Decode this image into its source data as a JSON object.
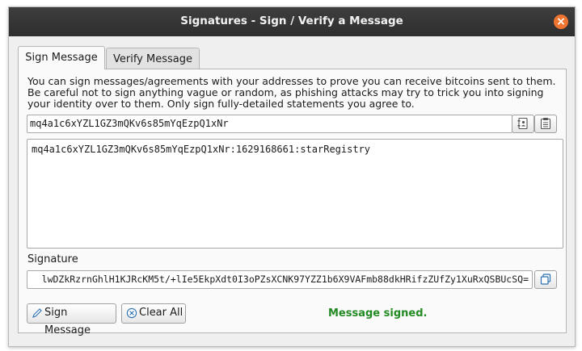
{
  "window": {
    "title": "Signatures - Sign / Verify a Message"
  },
  "tabs": [
    {
      "label": "Sign Message",
      "active": true
    },
    {
      "label": "Verify Message",
      "active": false
    }
  ],
  "sign": {
    "info": "You can sign messages/agreements with your addresses to prove you can receive bitcoins sent to them. Be careful not to sign anything vague or random, as phishing attacks may try to trick you into signing your identity over to them. Only sign fully-detailed statements you agree to.",
    "address": "mq4a1c6xYZL1GZ3mQKv6s85mYqEzpQ1xNr",
    "message": "mq4a1c6xYZL1GZ3mQKv6s85mYqEzpQ1xNr:1629168661:starRegistry",
    "signature_label": "Signature",
    "signature": "lwDZkRzrnGhlH1KJRcKM5t/+lIe5EkpXdt0I3oPZsXCNK97YZZ1b6X9VAFmb88dkHRifzZUfZy1XuRxQSBUcSQ=",
    "sign_button": "Sign Message",
    "clear_button": "Clear All",
    "status": "Message signed."
  },
  "colors": {
    "titlebar": "#353535",
    "close": "#ef7430",
    "status": "#238a23"
  },
  "icons": {
    "close": "close-icon",
    "address_book": "address-book-icon",
    "paste": "paste-icon",
    "copy": "copy-icon",
    "sign": "pen-icon",
    "clear": "clear-icon"
  }
}
